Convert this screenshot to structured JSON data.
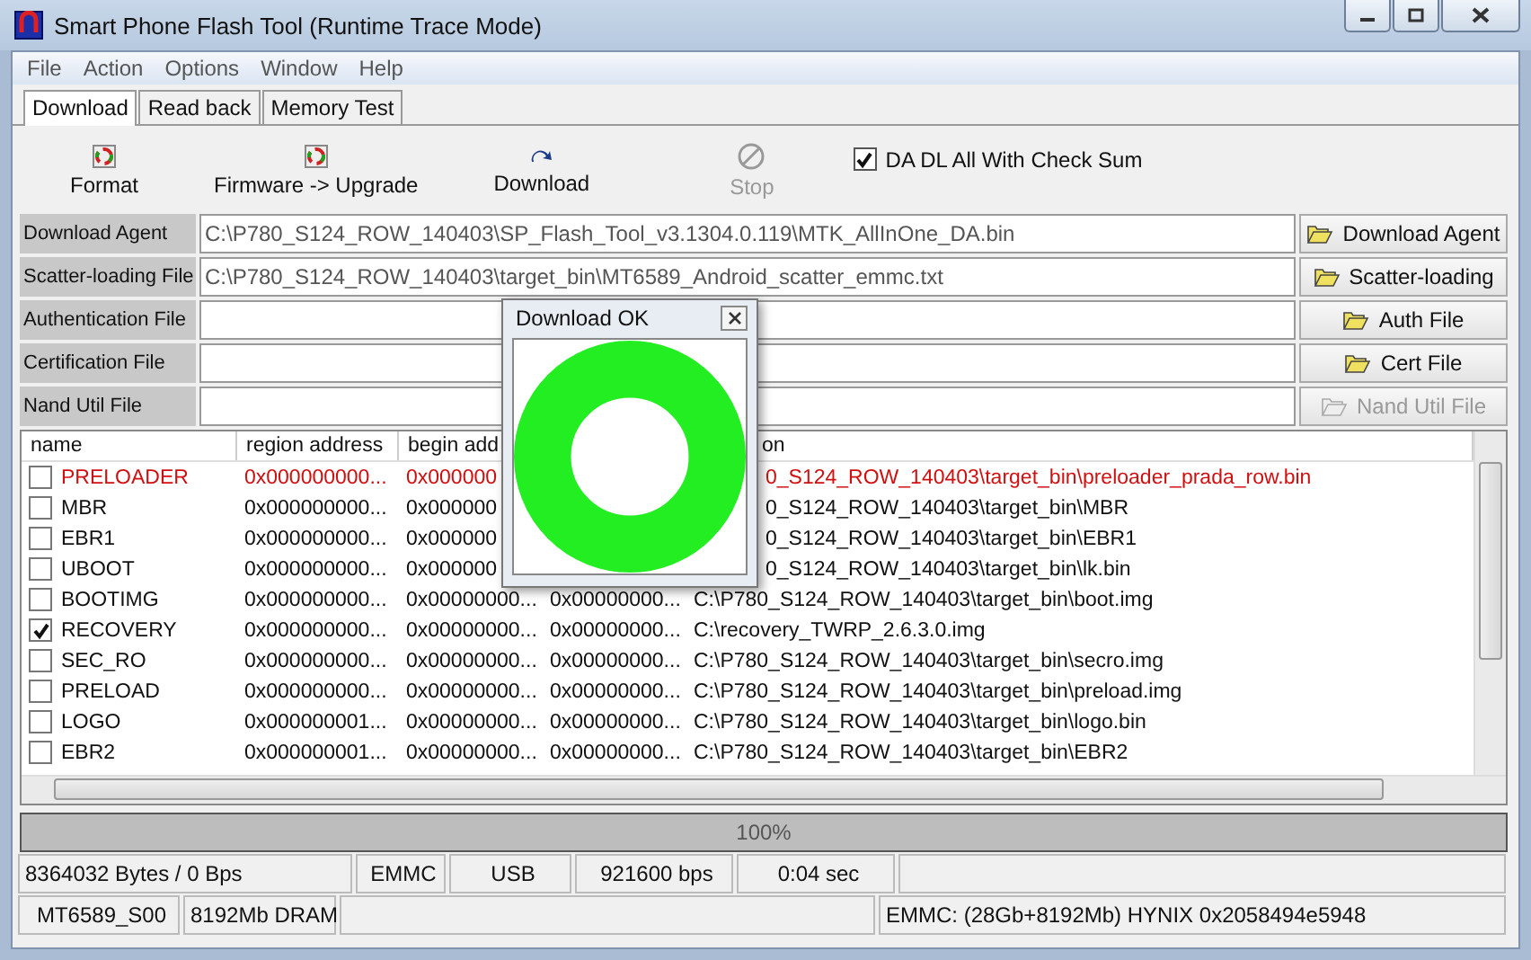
{
  "window": {
    "title": "Smart Phone Flash Tool (Runtime Trace Mode)"
  },
  "menu": [
    "File",
    "Action",
    "Options",
    "Window",
    "Help"
  ],
  "tabs": [
    {
      "label": "Download",
      "selected": true
    },
    {
      "label": "Read back",
      "selected": false
    },
    {
      "label": "Memory Test",
      "selected": false
    }
  ],
  "toolbar": [
    {
      "label": "Format",
      "kind": "recycle",
      "disabled": false
    },
    {
      "label": "Firmware -> Upgrade",
      "kind": "recycle",
      "disabled": false
    },
    {
      "label": "Download",
      "kind": "arrow",
      "disabled": false
    },
    {
      "label": "Stop",
      "kind": "stop",
      "disabled": true
    }
  ],
  "checksum": {
    "label": "DA DL All With Check Sum",
    "checked": true
  },
  "files": [
    {
      "label": "Download Agent",
      "value": "C:\\P780_S124_ROW_140403\\SP_Flash_Tool_v3.1304.0.119\\MTK_AllInOne_DA.bin",
      "button": "Download Agent",
      "disabled": false
    },
    {
      "label": "Scatter-loading File",
      "value": "C:\\P780_S124_ROW_140403\\target_bin\\MT6589_Android_scatter_emmc.txt",
      "button": "Scatter-loading",
      "disabled": false
    },
    {
      "label": "Authentication File",
      "button": "Auth File",
      "disabled": false
    },
    {
      "label": "Certification File",
      "button": "Cert File",
      "disabled": false
    },
    {
      "label": "Nand Util File",
      "button": "Nand Util File",
      "disabled": true
    }
  ],
  "table": {
    "columns": [
      "name",
      "region address",
      "begin add",
      "on"
    ],
    "rows": [
      {
        "name": "PRELOADER",
        "checked": false,
        "error": true,
        "region": "0x000000000...",
        "begin": "0x000000",
        "location": "0_S124_ROW_140403\\target_bin\\preloader_prada_row.bin",
        "covered": true
      },
      {
        "name": "MBR",
        "checked": false,
        "error": false,
        "region": "0x000000000...",
        "begin": "0x000000",
        "location": "0_S124_ROW_140403\\target_bin\\MBR",
        "covered": true
      },
      {
        "name": "EBR1",
        "checked": false,
        "error": false,
        "region": "0x000000000...",
        "begin": "0x000000",
        "location": "0_S124_ROW_140403\\target_bin\\EBR1",
        "covered": true
      },
      {
        "name": "UBOOT",
        "checked": false,
        "error": false,
        "region": "0x000000000...",
        "begin": "0x000000",
        "location": "0_S124_ROW_140403\\target_bin\\lk.bin",
        "covered": true
      },
      {
        "name": "BOOTIMG",
        "checked": false,
        "error": false,
        "region": "0x000000000...",
        "begin": "0x00000000...",
        "end": "0x00000000...",
        "location": "C:\\P780_S124_ROW_140403\\target_bin\\boot.img",
        "covered": false
      },
      {
        "name": "RECOVERY",
        "checked": true,
        "error": false,
        "region": "0x000000000...",
        "begin": "0x00000000...",
        "end": "0x00000000...",
        "location": "C:\\recovery_TWRP_2.6.3.0.img",
        "covered": false
      },
      {
        "name": "SEC_RO",
        "checked": false,
        "error": false,
        "region": "0x000000000...",
        "begin": "0x00000000...",
        "end": "0x00000000...",
        "location": "C:\\P780_S124_ROW_140403\\target_bin\\secro.img",
        "covered": false
      },
      {
        "name": "PRELOAD",
        "checked": false,
        "error": false,
        "region": "0x000000000...",
        "begin": "0x00000000...",
        "end": "0x00000000...",
        "location": "C:\\P780_S124_ROW_140403\\target_bin\\preload.img",
        "covered": false
      },
      {
        "name": "LOGO",
        "checked": false,
        "error": false,
        "region": "0x000000001...",
        "begin": "0x00000000...",
        "end": "0x00000000...",
        "location": "C:\\P780_S124_ROW_140403\\target_bin\\logo.bin",
        "covered": false
      },
      {
        "name": "EBR2",
        "checked": false,
        "error": false,
        "region": "0x000000001...",
        "begin": "0x00000000...",
        "end": "0x00000000...",
        "location": "C:\\P780_S124_ROW_140403\\target_bin\\EBR2",
        "covered": false
      }
    ]
  },
  "progress": {
    "label": "100%",
    "level": 1
  },
  "status": [
    [
      "8364032 Bytes / 0 Bps",
      "EMMC",
      "USB",
      "921600 bps",
      "0:04 sec"
    ],
    [
      "MT6589_S00",
      "8192Mb DRAM",
      "EMMC: (28Gb+8192Mb) HYNIX 0x2058494e5948"
    ]
  ],
  "dialog": {
    "title": "Download OK"
  }
}
